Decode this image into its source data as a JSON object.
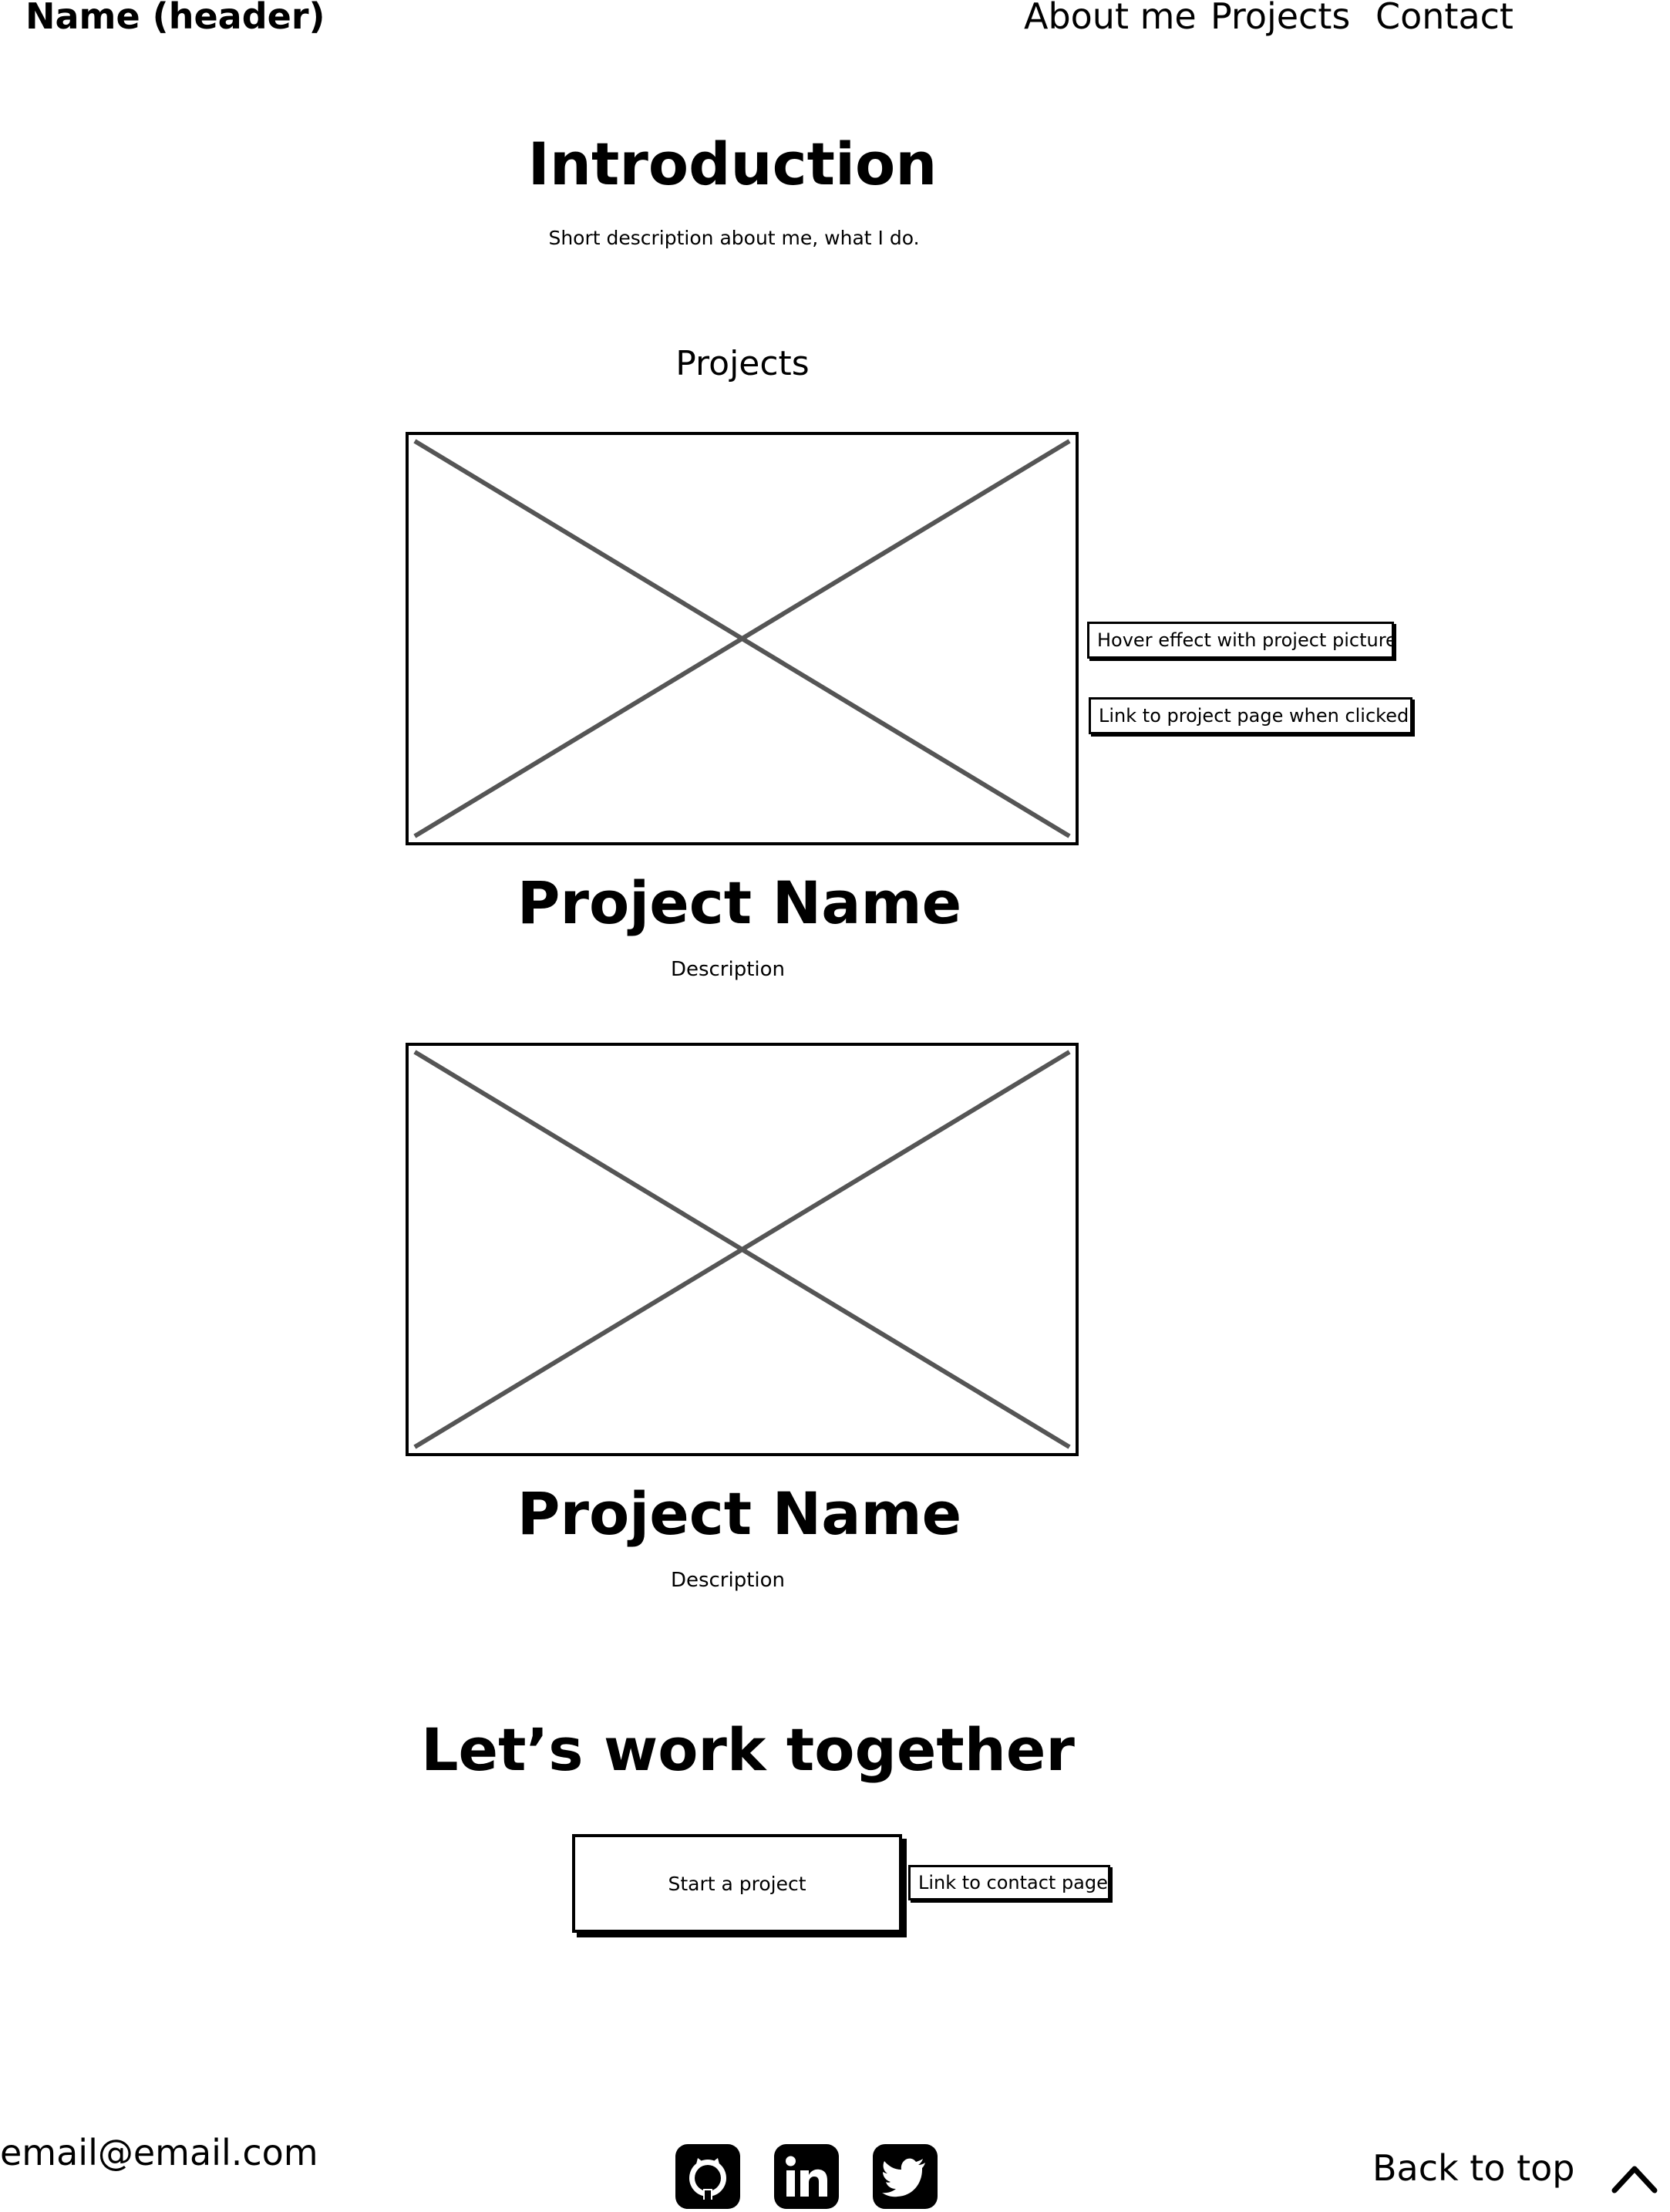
{
  "header": {
    "site_name": "Name (header)",
    "nav": [
      "About me",
      "Projects",
      "Contact"
    ]
  },
  "intro": {
    "title": "Introduction",
    "description": "Short description about me, what I do."
  },
  "projects": {
    "heading": "Projects",
    "items": [
      {
        "name": "Project Name",
        "description": "Description"
      },
      {
        "name": "Project Name",
        "description": "Description"
      }
    ],
    "annotations": [
      "Hover effect with project picture",
      "Link to project page when clicked"
    ]
  },
  "cta": {
    "title": "Let’s work together",
    "button_label": "Start a project",
    "annotation": "Link to contact page"
  },
  "footer": {
    "email": "email@email.com",
    "social_icons": [
      "github-icon",
      "linkedin-icon",
      "twitter-icon"
    ],
    "back_to_top": "Back to top"
  },
  "colors": {
    "ink": "#000000",
    "placeholder_cross": "#555555",
    "background": "#ffffff"
  }
}
